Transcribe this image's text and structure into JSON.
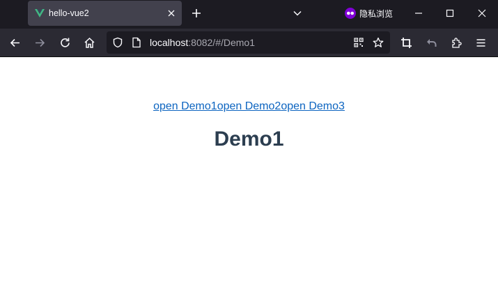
{
  "browser": {
    "tab": {
      "title": "hello-vue2",
      "favicon": "vue-logo-icon"
    },
    "private_label": "隐私浏览",
    "url": {
      "host": "localhost",
      "rest": ":8082/#/Demo1"
    },
    "colors": {
      "titlebar": "#1c1b22",
      "tab_active": "#42414d",
      "toolbar": "#2b2a33",
      "urlbar": "#1c1b22",
      "private_badge": "#8000d7",
      "vue_green": "#42b883"
    }
  },
  "page": {
    "links": [
      {
        "label": "open Demo1"
      },
      {
        "label": "open Demo2"
      },
      {
        "label": "open Demo3"
      }
    ],
    "heading": "Demo1",
    "colors": {
      "link": "#0c64c0",
      "heading": "#2c3e50"
    }
  }
}
